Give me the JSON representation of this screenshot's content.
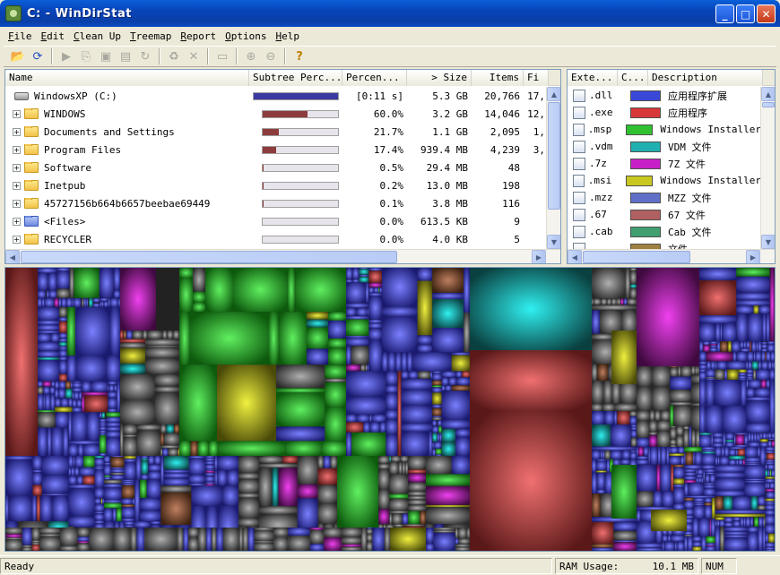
{
  "window": {
    "title": "C: - WinDirStat",
    "min": "_",
    "max": "□",
    "close": "✕"
  },
  "menu": [
    {
      "label": "File",
      "key": "F",
      "rest": "ile"
    },
    {
      "label": "Edit",
      "key": "E",
      "rest": "dit"
    },
    {
      "label": "Clean Up",
      "key": "C",
      "rest": "lean Up"
    },
    {
      "label": "Treemap",
      "key": "T",
      "rest": "reemap"
    },
    {
      "label": "Report",
      "key": "R",
      "rest": "eport"
    },
    {
      "label": "Options",
      "key": "O",
      "rest": "ptions"
    },
    {
      "label": "Help",
      "key": "H",
      "rest": "elp"
    }
  ],
  "toolbar": {
    "buttons": [
      {
        "name": "open",
        "glyph": "📂",
        "enabled": true
      },
      {
        "name": "refresh",
        "glyph": "⟳",
        "enabled": true
      },
      {
        "name": "sep"
      },
      {
        "name": "play",
        "glyph": "▶",
        "enabled": false
      },
      {
        "name": "copy",
        "glyph": "⎘",
        "enabled": false
      },
      {
        "name": "explorer",
        "glyph": "▣",
        "enabled": false
      },
      {
        "name": "cmd",
        "glyph": "▤",
        "enabled": false
      },
      {
        "name": "refresh-selected",
        "glyph": "↻",
        "enabled": false
      },
      {
        "name": "sep"
      },
      {
        "name": "recycle",
        "glyph": "♻",
        "enabled": false
      },
      {
        "name": "delete",
        "glyph": "✕",
        "enabled": false
      },
      {
        "name": "sep"
      },
      {
        "name": "new-folder",
        "glyph": "▭",
        "enabled": false
      },
      {
        "name": "sep"
      },
      {
        "name": "zoom-in",
        "glyph": "⊕",
        "enabled": false
      },
      {
        "name": "zoom-out",
        "glyph": "⊖",
        "enabled": false
      },
      {
        "name": "sep"
      },
      {
        "name": "help",
        "glyph": "?",
        "enabled": true
      }
    ]
  },
  "dirlist": {
    "columns": [
      "Name",
      "Subtree Perc...",
      "Percen...",
      "> Size",
      "Items",
      "Fi"
    ],
    "rows": [
      {
        "name": "WindowsXP (C:)",
        "type": "drive",
        "bar": 1.0,
        "bar_color": "#3a3aa0",
        "pct": "[0:11 s]",
        "size": "5.3 GB",
        "items": "20,766",
        "files": "17,"
      },
      {
        "name": "WINDOWS",
        "type": "folder",
        "bar": 0.6,
        "bar_color": "#8c3c3c",
        "pct": "60.0%",
        "size": "3.2 GB",
        "items": "14,046",
        "files": "12,"
      },
      {
        "name": "Documents and Settings",
        "type": "folder",
        "bar": 0.217,
        "bar_color": "#8c3c3c",
        "pct": "21.7%",
        "size": "1.1 GB",
        "items": "2,095",
        "files": "1,"
      },
      {
        "name": "Program Files",
        "type": "folder",
        "bar": 0.174,
        "bar_color": "#8c3c3c",
        "pct": "17.4%",
        "size": "939.4 MB",
        "items": "4,239",
        "files": "3,"
      },
      {
        "name": "Software",
        "type": "folder",
        "bar": 0.005,
        "bar_color": "#8c3c3c",
        "pct": "0.5%",
        "size": "29.4 MB",
        "items": "48",
        "files": ""
      },
      {
        "name": "Inetpub",
        "type": "folder",
        "bar": 0.002,
        "bar_color": "#8c3c3c",
        "pct": "0.2%",
        "size": "13.0 MB",
        "items": "198",
        "files": ""
      },
      {
        "name": "45727156b664b6657beebae69449",
        "type": "folder",
        "bar": 0.001,
        "bar_color": "#8c3c3c",
        "pct": "0.1%",
        "size": "3.8 MB",
        "items": "116",
        "files": ""
      },
      {
        "name": "<Files>",
        "type": "files",
        "bar": 0.0,
        "bar_color": "#8c3c3c",
        "pct": "0.0%",
        "size": "613.5 KB",
        "items": "9",
        "files": ""
      },
      {
        "name": "RECYCLER",
        "type": "folder",
        "bar": 0.0,
        "bar_color": "#8c3c3c",
        "pct": "0.0%",
        "size": "4.0 KB",
        "items": "5",
        "files": ""
      }
    ]
  },
  "extlist": {
    "columns": [
      "Exte...",
      "C...",
      "Description"
    ],
    "rows": [
      {
        "ext": ".dll",
        "color": "#3a48d8",
        "desc": "应用程序扩展"
      },
      {
        "ext": ".exe",
        "color": "#d83838",
        "desc": "应用程序"
      },
      {
        "ext": ".msp",
        "color": "#30c030",
        "desc": "Windows Installer"
      },
      {
        "ext": ".vdm",
        "color": "#20b0b0",
        "desc": "VDM 文件"
      },
      {
        "ext": ".7z",
        "color": "#c820c8",
        "desc": "7Z 文件"
      },
      {
        "ext": ".msi",
        "color": "#c8c820",
        "desc": "Windows Installer"
      },
      {
        "ext": ".mzz",
        "color": "#6070c8",
        "desc": "MZZ 文件"
      },
      {
        "ext": ".67",
        "color": "#b06060",
        "desc": "67 文件"
      },
      {
        "ext": ".cab",
        "color": "#40a070",
        "desc": "Cab 文件"
      },
      {
        "ext": "",
        "color": "#a08040",
        "desc": "文件"
      }
    ]
  },
  "status": {
    "text": "Ready",
    "ram_label": "RAM Usage:",
    "ram_value": "10.1 MB",
    "num": "NUM"
  }
}
